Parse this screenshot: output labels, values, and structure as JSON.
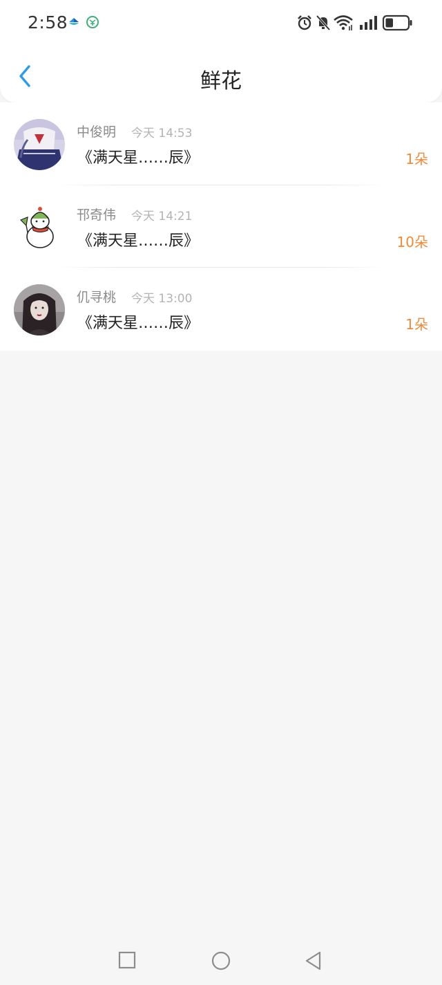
{
  "status_bar": {
    "time": "2:58",
    "left_icons": [
      "app-notification-icon",
      "app-badge-icon"
    ],
    "right_icons": [
      "alarm-icon",
      "mute-icon",
      "wifi-icon",
      "signal-icon",
      "battery-icon"
    ],
    "battery_level": 0.35
  },
  "header": {
    "title": "鲜花",
    "back_icon": "chevron-left-icon"
  },
  "list": [
    {
      "name": "中俊明",
      "time": "今天 14:53",
      "gift": "《满天星……辰》",
      "count": "1朵"
    },
    {
      "name": "邗奇伟",
      "time": "今天 14:21",
      "gift": "《满天星……辰》",
      "count": "10朵"
    },
    {
      "name": "仉寻桃",
      "time": "今天 13:00",
      "gift": "《满天星……辰》",
      "count": "1朵"
    }
  ],
  "colors": {
    "accent": "#2f9ae6",
    "count": "#f08a3a",
    "background": "#f7f6f7"
  },
  "system_nav": [
    "recent-apps-icon",
    "home-icon",
    "back-icon"
  ]
}
